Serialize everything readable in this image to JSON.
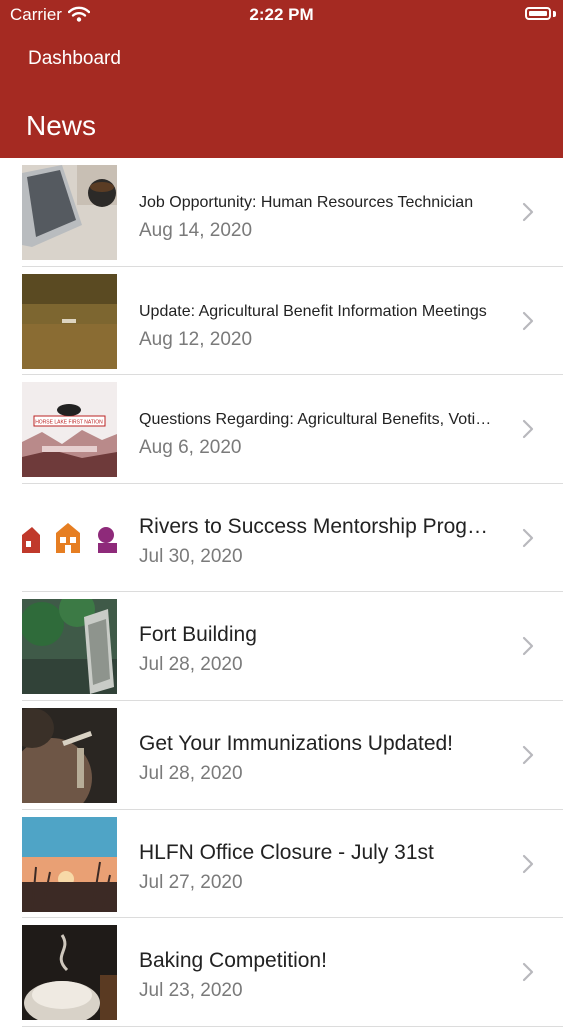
{
  "status_bar": {
    "carrier": "Carrier",
    "time": "2:22 PM"
  },
  "nav": {
    "back_label": "Dashboard",
    "title": "News"
  },
  "colors": {
    "header_bg": "#a52a22"
  },
  "articles": [
    {
      "title": "Job Opportunity: Human Resources Technician",
      "date": "Aug 14, 2020",
      "thumbnail": "laptop-coffee-image"
    },
    {
      "title": "Update: Agricultural Benefit Information Meetings",
      "date": "Aug 12, 2020",
      "thumbnail": "farm-field-image"
    },
    {
      "title": "Questions Regarding: Agricultural Benefits, Voting P...",
      "date": "Aug 6, 2020",
      "thumbnail": "horse-lake-logo-image",
      "logo_text": "HORSE LAKE FIRST NATION"
    },
    {
      "title": "Rivers to Success Mentorship Program",
      "date": "Jul 30, 2020",
      "thumbnail": "community-icons-image"
    },
    {
      "title": "Fort Building",
      "date": "Jul 28, 2020",
      "thumbnail": "fort-trees-image"
    },
    {
      "title": "Get Your Immunizations Updated!",
      "date": "Jul 28, 2020",
      "thumbnail": "immunization-image"
    },
    {
      "title": "HLFN Office Closure - July 31st",
      "date": "Jul 27, 2020",
      "thumbnail": "sunset-image"
    },
    {
      "title": "Baking Competition!",
      "date": "Jul 23, 2020",
      "thumbnail": "baking-image"
    }
  ]
}
